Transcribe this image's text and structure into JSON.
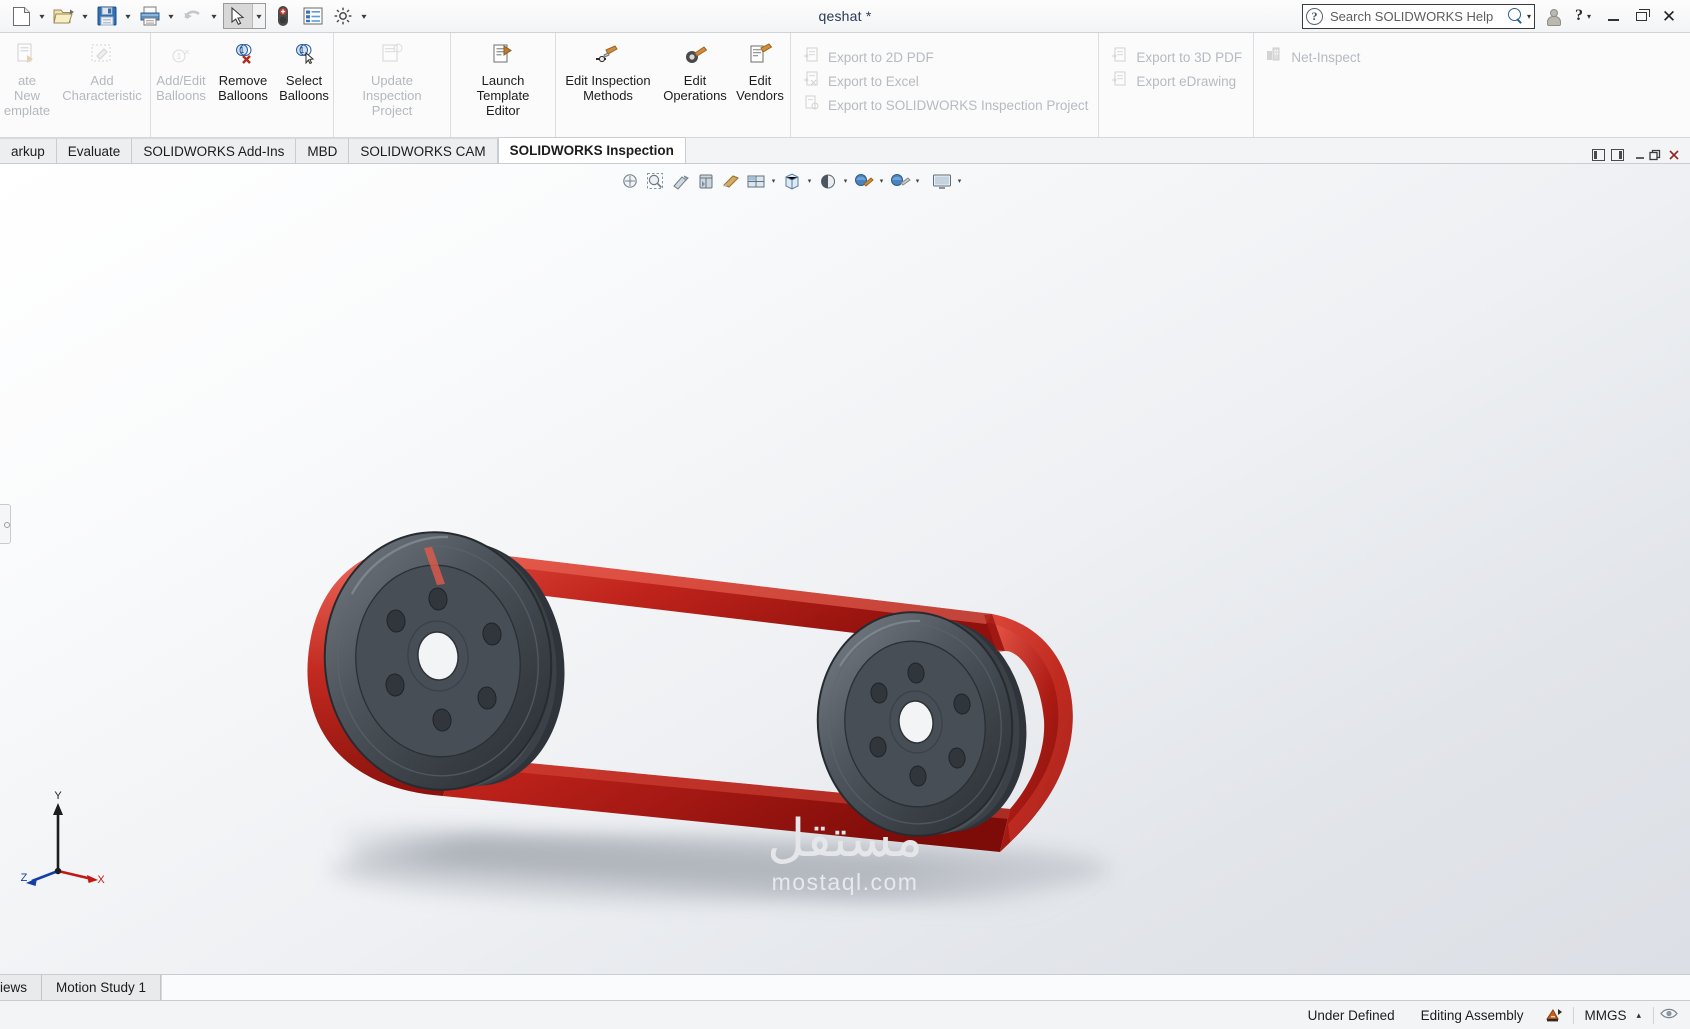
{
  "window": {
    "title": "qeshat *",
    "search_placeholder": "Search SOLIDWORKS Help",
    "help_label": "?",
    "minimize_label": "Minimize",
    "maximize_label": "Restore",
    "close_label": "Close",
    "account_label": "Account"
  },
  "quick_access": {
    "items": [
      {
        "name": "new-document",
        "icon": "page-icon",
        "has_dropdown": true
      },
      {
        "name": "open-document",
        "icon": "folder-open-icon",
        "has_dropdown": true
      },
      {
        "name": "save-document",
        "icon": "floppy-disk-icon",
        "has_dropdown": true
      },
      {
        "name": "print-document",
        "icon": "printer-icon",
        "has_dropdown": true
      },
      {
        "name": "undo",
        "icon": "undo-arrow-icon",
        "has_dropdown": true
      },
      {
        "name": "select-pointer",
        "icon": "cursor-arrow-icon",
        "has_dropdown": true
      },
      {
        "name": "rebuild",
        "icon": "traffic-light-icon",
        "has_dropdown": false
      },
      {
        "name": "file-properties",
        "icon": "list-panel-icon",
        "has_dropdown": false
      },
      {
        "name": "options",
        "icon": "gear-icon",
        "has_dropdown": true
      }
    ]
  },
  "ribbon": {
    "groups": [
      {
        "name": "template-group",
        "commands": [
          {
            "label": "ate New\nemplate",
            "icon": "new-template-icon",
            "enabled": false
          },
          {
            "label": "Add\nCharacteristic",
            "icon": "add-characteristic-icon",
            "enabled": false
          }
        ]
      },
      {
        "name": "balloons-group",
        "commands": [
          {
            "label": "Add/Edit\nBalloons",
            "icon": "add-edit-balloons-icon",
            "enabled": false
          },
          {
            "label": "Remove\nBalloons",
            "icon": "remove-balloons-icon",
            "enabled": true
          },
          {
            "label": "Select\nBalloons",
            "icon": "select-balloons-icon",
            "enabled": true
          }
        ]
      },
      {
        "name": "project-group",
        "commands": [
          {
            "label": "Update Inspection\nProject",
            "icon": "update-project-icon",
            "enabled": false
          }
        ]
      },
      {
        "name": "editor-group",
        "commands": [
          {
            "label": "Launch\nTemplate Editor",
            "icon": "launch-template-editor-icon",
            "enabled": true
          }
        ]
      },
      {
        "name": "edit-group",
        "commands": [
          {
            "label": "Edit Inspection\nMethods",
            "icon": "edit-inspection-methods-icon",
            "enabled": true
          },
          {
            "label": "Edit\nOperations",
            "icon": "edit-operations-icon",
            "enabled": true
          },
          {
            "label": "Edit\nVendors",
            "icon": "edit-vendors-icon",
            "enabled": true
          }
        ]
      }
    ],
    "export_column_1": [
      {
        "label": "Export to 2D PDF",
        "icon": "export-pdf-icon",
        "enabled": false
      },
      {
        "label": "Export to Excel",
        "icon": "export-excel-icon",
        "enabled": false
      },
      {
        "label": "Export to SOLIDWORKS Inspection Project",
        "icon": "export-inspection-icon",
        "enabled": false
      }
    ],
    "export_column_2": [
      {
        "label": "Export to 3D PDF",
        "icon": "export-3dpdf-icon",
        "enabled": false
      },
      {
        "label": "Export eDrawing",
        "icon": "export-edrawing-icon",
        "enabled": false
      }
    ],
    "net_inspect": [
      {
        "label": "Net-Inspect",
        "icon": "net-inspect-icon",
        "enabled": false
      }
    ]
  },
  "command_tabs": {
    "tabs": [
      {
        "label": "arkup",
        "active": false
      },
      {
        "label": "Evaluate",
        "active": false
      },
      {
        "label": "SOLIDWORKS Add-Ins",
        "active": false
      },
      {
        "label": "MBD",
        "active": false
      },
      {
        "label": "SOLIDWORKS CAM",
        "active": false
      },
      {
        "label": "SOLIDWORKS Inspection",
        "active": true
      }
    ],
    "right_controls": [
      {
        "name": "panel-left-icon"
      },
      {
        "name": "panel-right-icon"
      },
      {
        "name": "minimize-doc-icon"
      },
      {
        "name": "restore-doc-icon"
      },
      {
        "name": "close-doc-icon"
      }
    ]
  },
  "view_toolbar": {
    "items": [
      {
        "name": "zoom-to-fit-icon",
        "dropdown": false
      },
      {
        "name": "zoom-to-area-icon",
        "dropdown": false
      },
      {
        "name": "section-view-icon",
        "dropdown": false
      },
      {
        "name": "view-orientation-icon",
        "dropdown": false
      },
      {
        "name": "display-style-icon",
        "dropdown": false
      },
      {
        "name": "hide-show-items-icon",
        "dropdown": true
      },
      {
        "name": "edit-appearance-icon",
        "dropdown": true
      },
      {
        "name": "apply-scene-icon",
        "dropdown": true
      },
      {
        "name": "view-settings-icon",
        "dropdown": true
      },
      {
        "name": "display-manager-icon",
        "dropdown": true
      }
    ]
  },
  "viewport": {
    "model_name": "belt-pulley-assembly",
    "triad_axes": {
      "x": "X",
      "y": "Y",
      "z": "Z"
    },
    "colors": {
      "belt": "#b01c17",
      "belt_highlight": "#d93b33",
      "pulley_dark": "#3c4147",
      "pulley_mid": "#5a6067",
      "background_top": "#ffffff",
      "background_bottom": "#dcdfe5"
    }
  },
  "watermark": {
    "arabic": "مستقل",
    "latin": "mostaql.com"
  },
  "bottom_tabs": {
    "tabs": [
      {
        "label": "iews",
        "active": false
      },
      {
        "label": "Motion Study 1",
        "active": false
      }
    ]
  },
  "status_bar": {
    "state": "Under Defined",
    "mode": "Editing Assembly",
    "mode_icon": "assembly-icon",
    "units": "MMGS",
    "units_caret": "▴",
    "overlay_icon": "overlay-icon"
  }
}
